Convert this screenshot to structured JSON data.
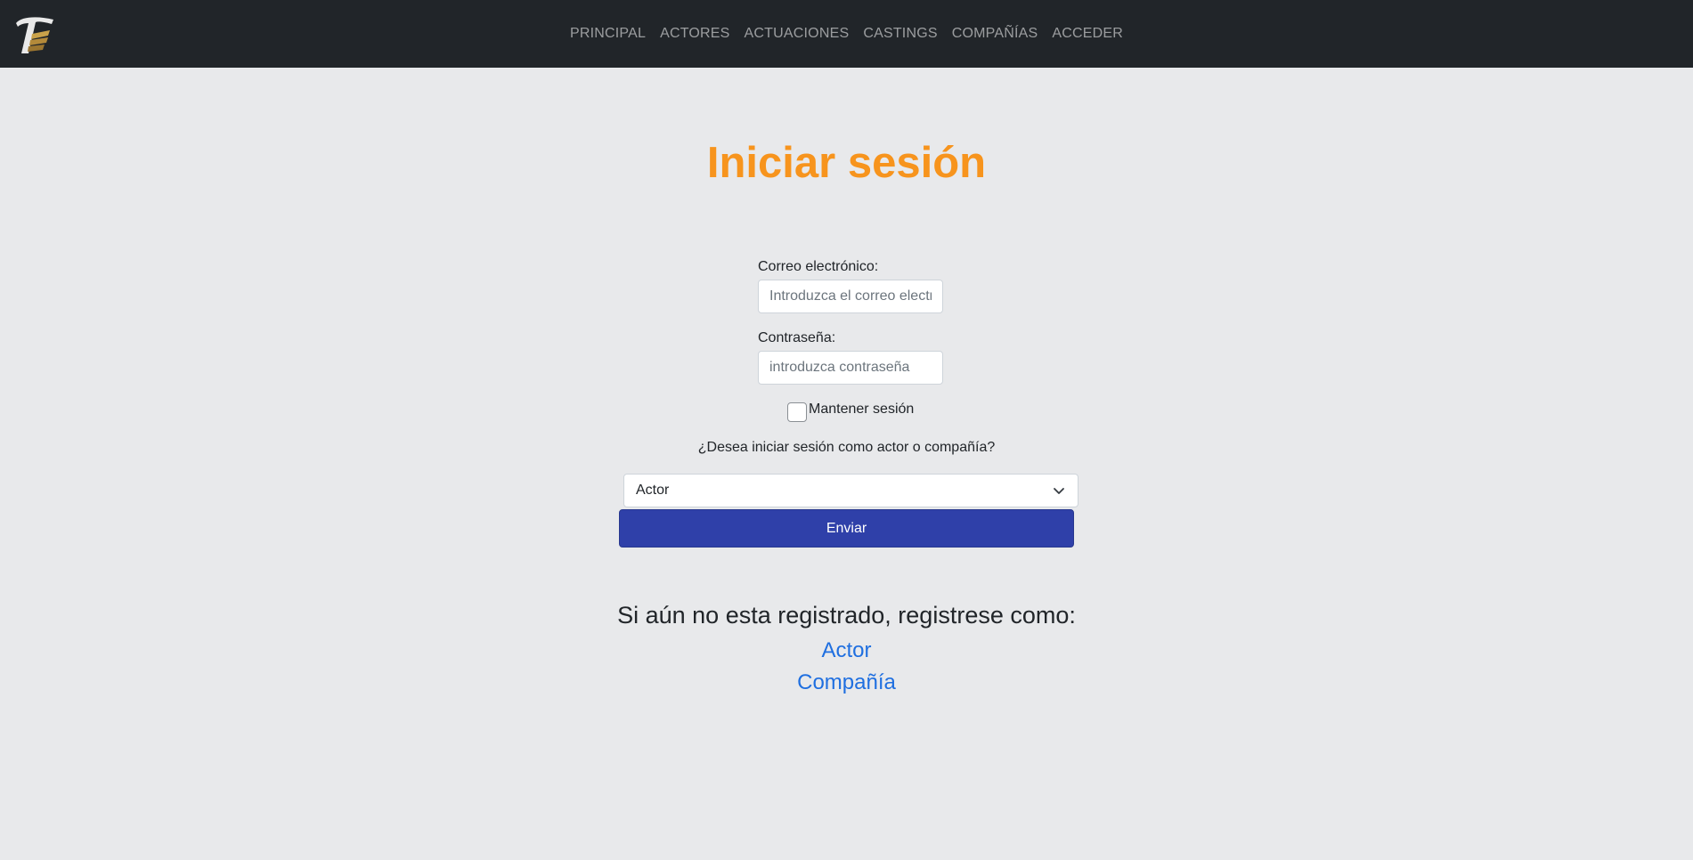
{
  "nav": {
    "logo_icon": "theatre-t-logo-icon",
    "items": [
      {
        "label": "PRINCIPAL"
      },
      {
        "label": "ACTORES"
      },
      {
        "label": "ACTUACIONES"
      },
      {
        "label": "CASTINGS"
      },
      {
        "label": "COMPAÑÍAS"
      },
      {
        "label": "ACCEDER"
      }
    ]
  },
  "login": {
    "title": "Iniciar sesión",
    "email_label": "Correo electrónico:",
    "email_placeholder": "Introduzca el correo electrónico",
    "password_label": "Contraseña:",
    "password_placeholder": "introduzca contraseña",
    "remember_label": "Mantener sesión",
    "question": "¿Desea iniciar sesión como actor o compañía?",
    "select_value": "Actor",
    "submit_label": "Enviar"
  },
  "register": {
    "text": "Si aún no esta registrado, registrese como:",
    "link_actor": "Actor",
    "link_company": "Compañía"
  },
  "colors": {
    "navbar": "#212529",
    "title": "#f7941d",
    "button": "#2f40a9",
    "link": "#1f6fe0",
    "background": "#e8e9eb"
  }
}
